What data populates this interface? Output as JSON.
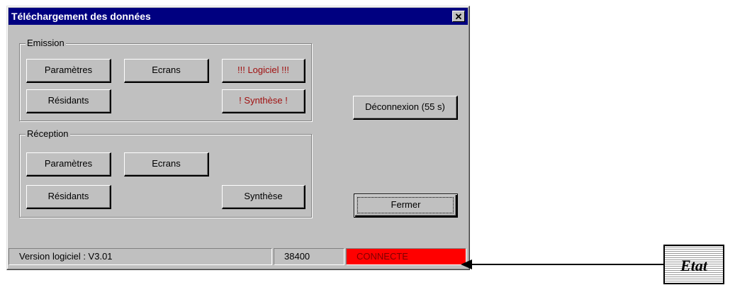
{
  "window": {
    "title": "Téléchargement des données",
    "close_glyph": "✕"
  },
  "emission": {
    "legend": "Emission",
    "parametres": "Paramètres",
    "ecrans": "Ecrans",
    "logiciel": "!!! Logiciel !!!",
    "residants": "Résidants",
    "synthese": "! Synthèse !"
  },
  "reception": {
    "legend": "Réception",
    "parametres": "Paramètres",
    "ecrans": "Ecrans",
    "residants": "Résidants",
    "synthese": "Synthèse"
  },
  "actions": {
    "deconnexion": "Déconnexion (55 s)",
    "fermer": "Fermer"
  },
  "statusbar": {
    "version": "Version logiciel : V3.01",
    "baud": "38400",
    "state": "CONNECTE",
    "state_color": "#ff0000"
  },
  "annotation": {
    "label": "Etat"
  },
  "colors": {
    "titlebar": "#000080",
    "face": "#c0c0c0",
    "warning_text": "#a01010"
  }
}
